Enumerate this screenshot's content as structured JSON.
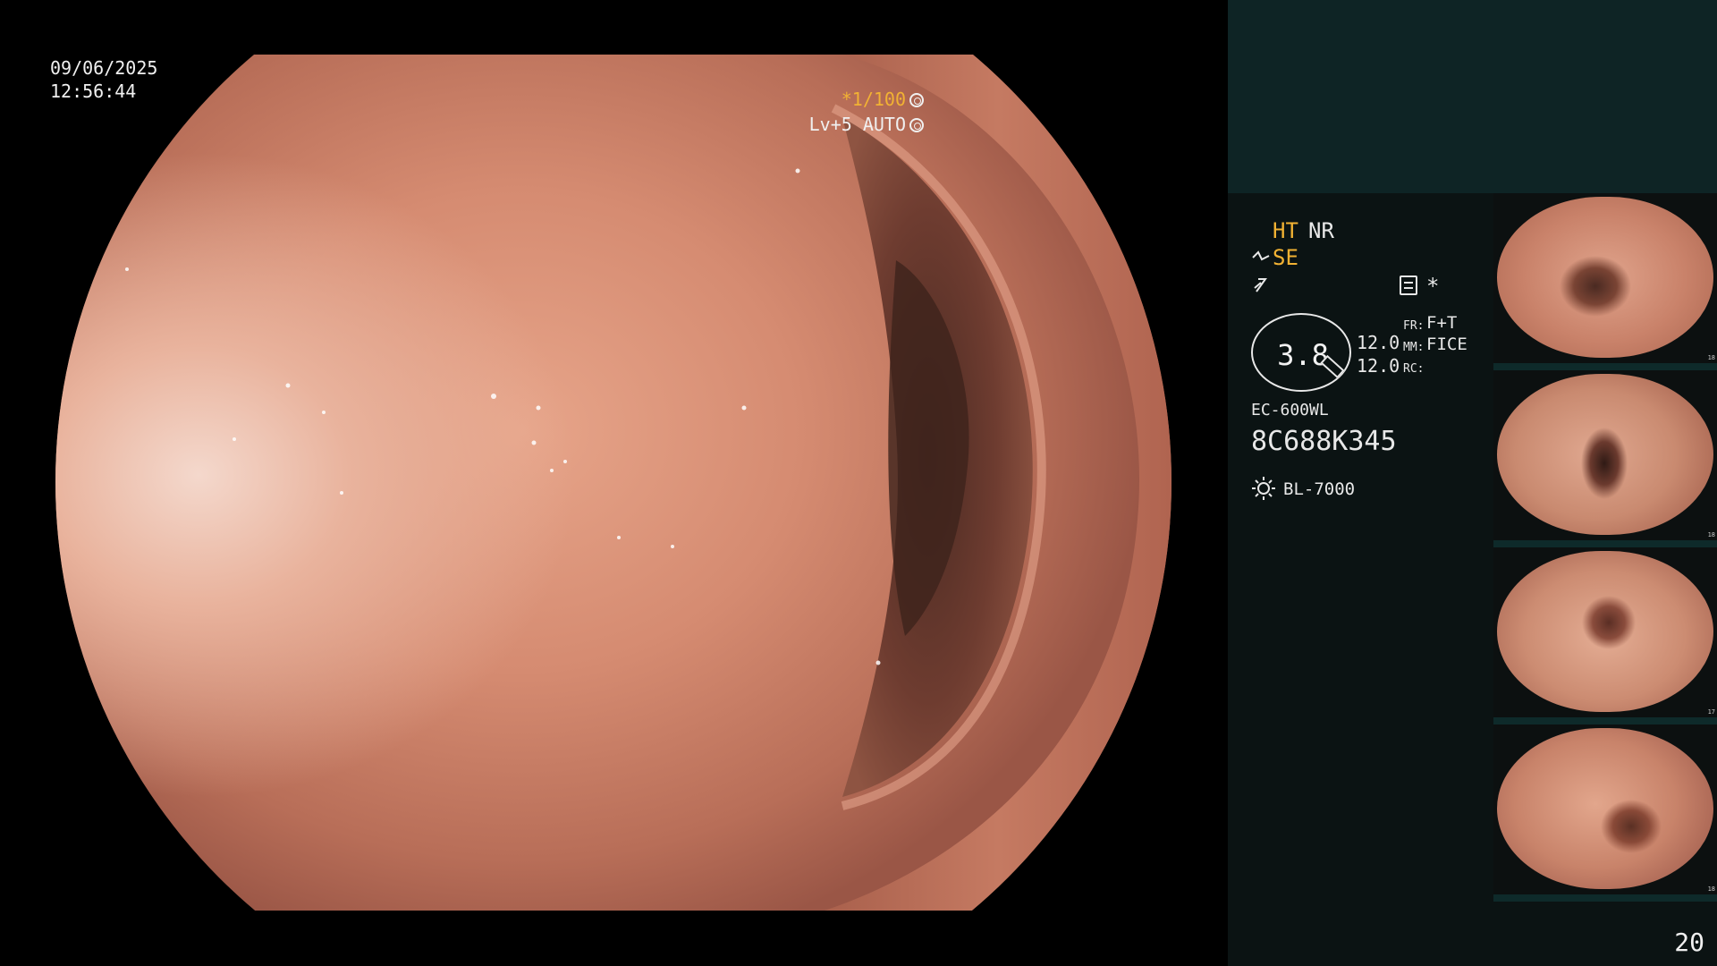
{
  "overlay": {
    "date": "09/06/2025",
    "time": "12:56:44",
    "shutter_speed": "*1/100",
    "level": "Lv+5",
    "exposure_mode": "AUTO"
  },
  "panel": {
    "ht_label": "HT",
    "nr_label": "NR",
    "se_label": "SE",
    "gauge_value": "3.8",
    "value_top": "12.0",
    "value_bottom": "12.0",
    "fr_label": "FR:",
    "fr_value": "F+T",
    "mm_label": "MM:",
    "mm_value": "FICE",
    "rc_label": "RC:",
    "star_symbol": "*",
    "scope_model": "EC-600WL",
    "scope_serial": "8C688K345",
    "light_source": "BL-7000",
    "page_number": "20"
  },
  "thumbnails": [
    {
      "marker": "18"
    },
    {
      "marker": "18"
    },
    {
      "marker": "17"
    },
    {
      "marker": "18"
    }
  ],
  "colors": {
    "accent_amber": "#f2b233",
    "panel_bg": "#0b1313",
    "panel_top": "#0e2425",
    "mucosa": "#d58b71"
  },
  "icons": [
    "shutter-icon",
    "auto-exposure-icon",
    "structure-enhance-icon",
    "color-tone-icon",
    "settings-icon",
    "light-source-icon"
  ]
}
